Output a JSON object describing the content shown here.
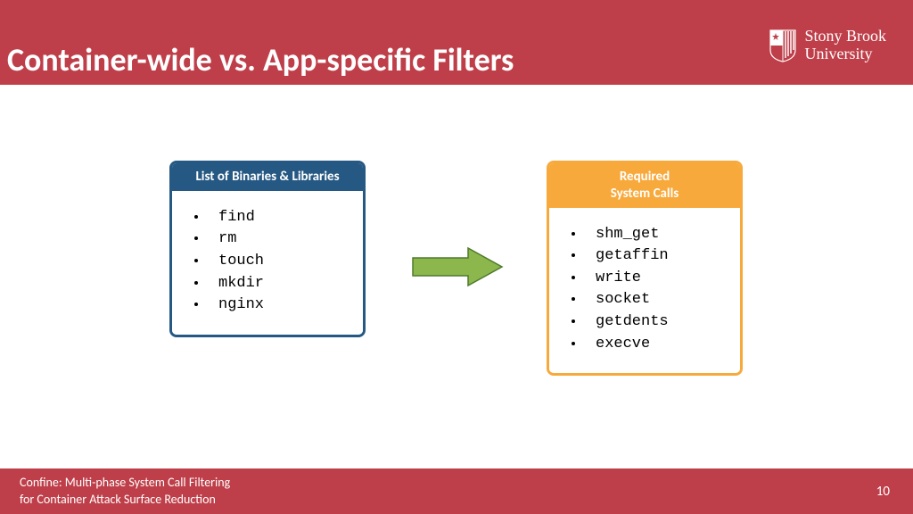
{
  "header": {
    "title": "Container-wide vs. App-specific Filters",
    "logo_line1": "Stony Brook",
    "logo_line2": "University"
  },
  "left_box": {
    "heading": "List of Binaries & Libraries",
    "items": [
      "find",
      "rm",
      "touch",
      "mkdir",
      "nginx"
    ]
  },
  "right_box": {
    "heading": "Required System Calls",
    "items": [
      "shm_get",
      "getaffin",
      "write",
      "socket",
      "getdents",
      "execve"
    ]
  },
  "footer": {
    "line1": "Confine: Multi-phase System Call Filtering",
    "line2": "for Container Attack Surface Reduction",
    "page": "10"
  },
  "colors": {
    "brand_red": "#BE3F49",
    "box_blue": "#255883",
    "box_orange": "#F8A93B",
    "arrow_green": "#8CB74D"
  }
}
